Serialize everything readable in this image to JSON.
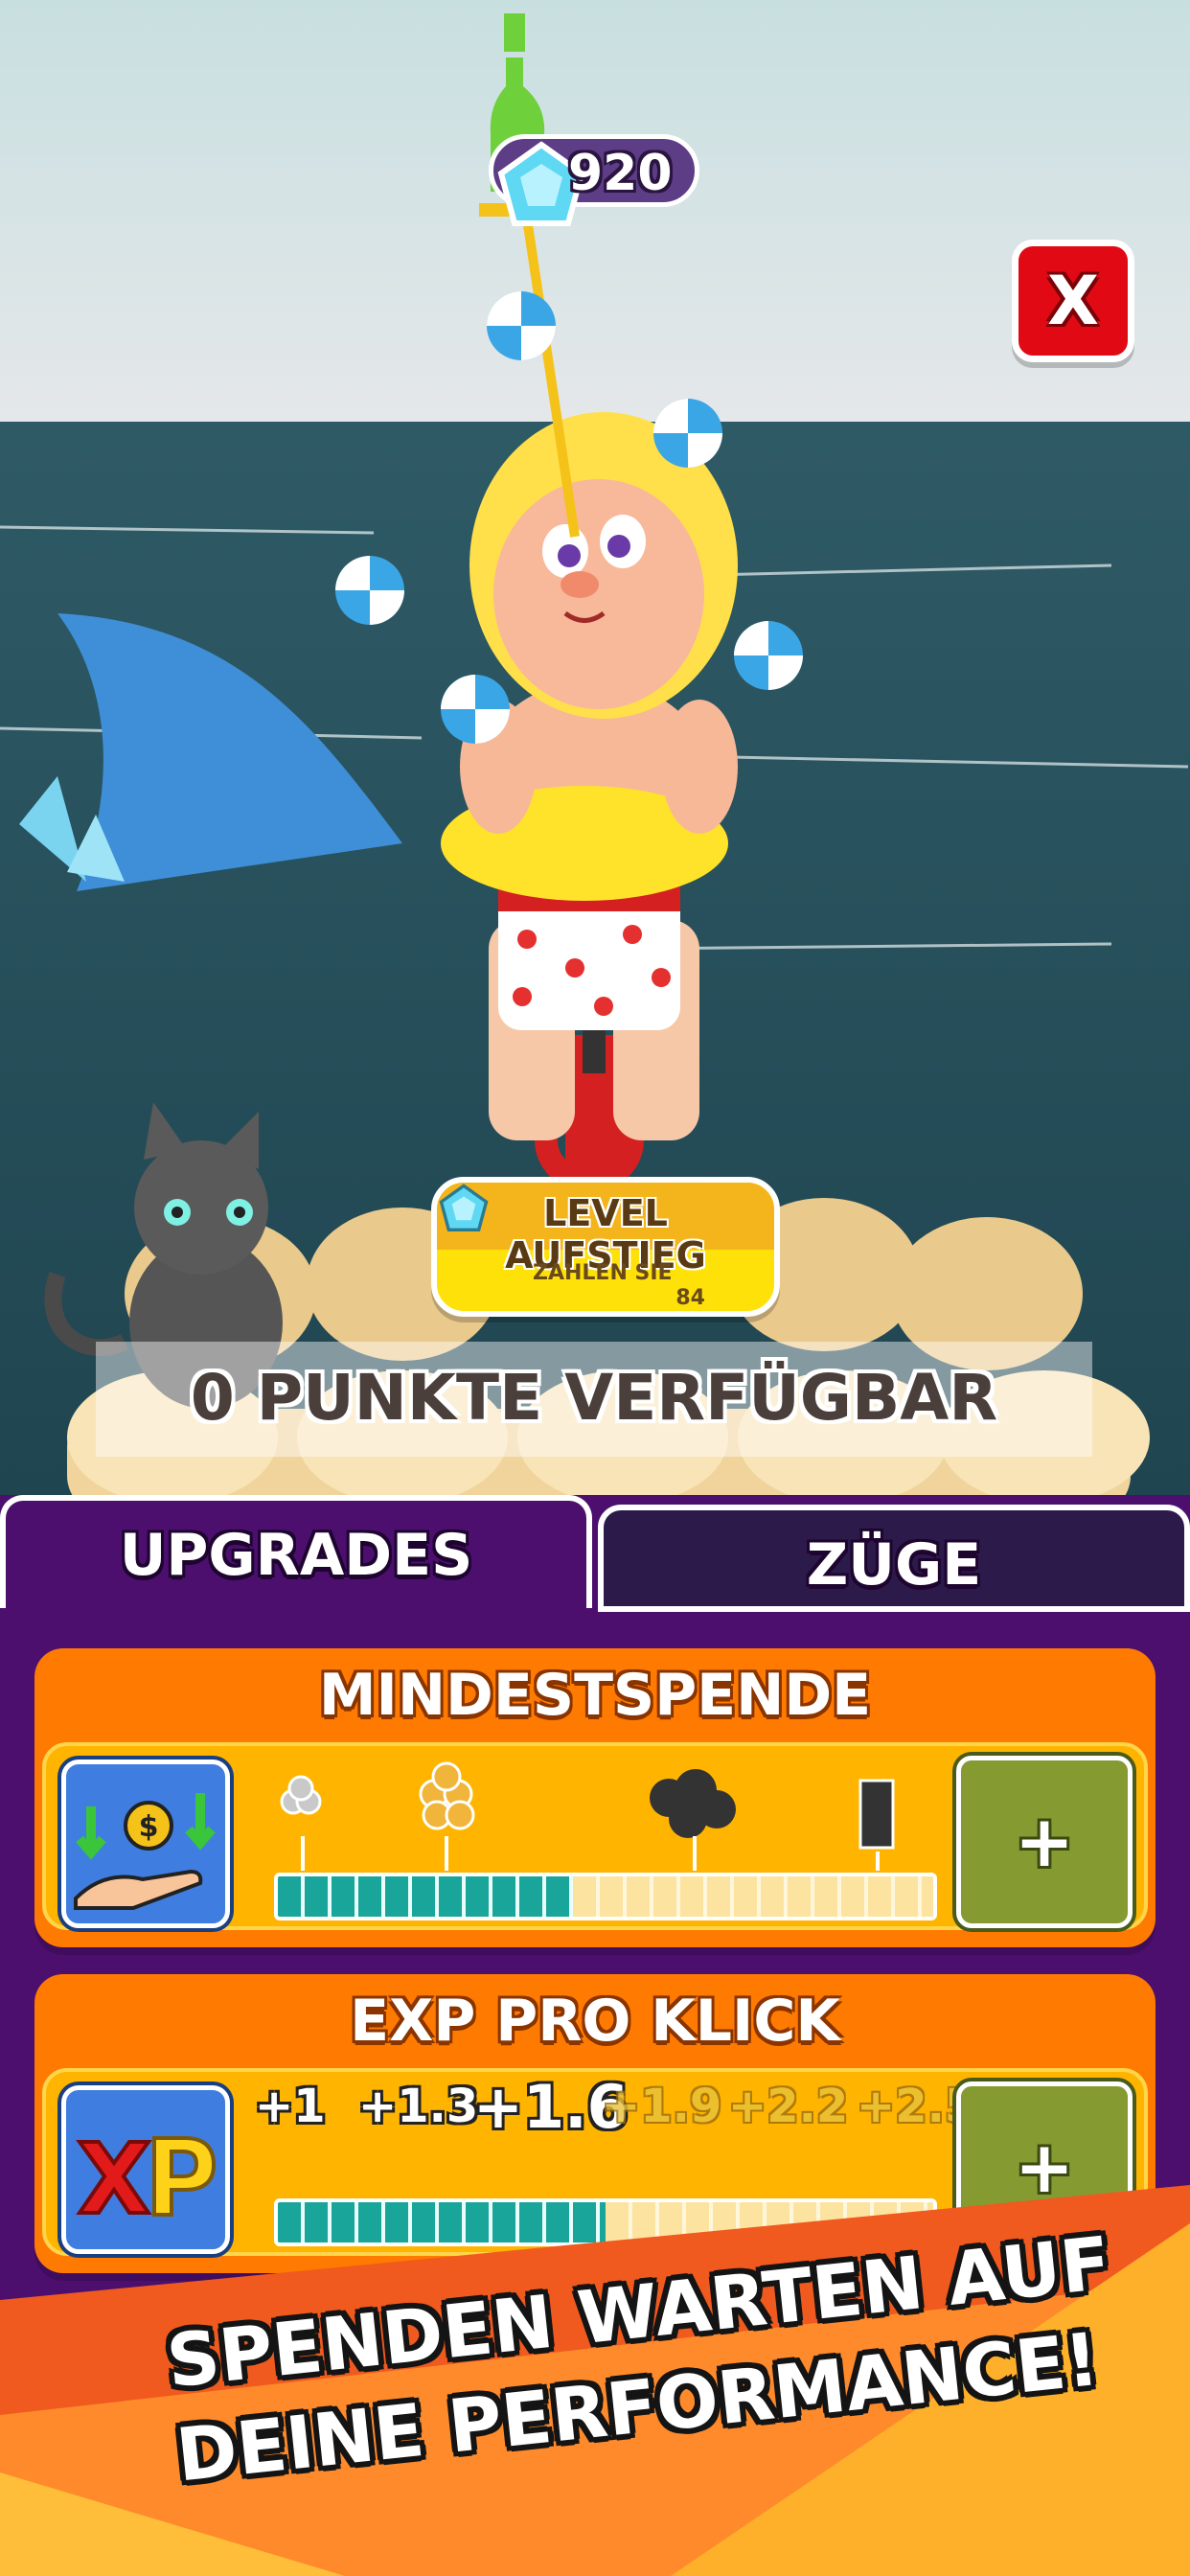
{
  "hud": {
    "gems": "920",
    "close_label": "X"
  },
  "level_up": {
    "title": "LEVEL AUFSTIEG",
    "subtitle": "ZAHLEN SIE",
    "cost": "84"
  },
  "points": {
    "label": "0 PUNKTE VERFÜGBAR"
  },
  "tabs": [
    {
      "label": "UPGRADES",
      "active": true
    },
    {
      "label": "ZÜGE",
      "active": false
    }
  ],
  "upgrades": [
    {
      "title": "MINDESTSPENDE",
      "plus_label": "+",
      "progress": 0.45,
      "icon": "donation-hand-icon"
    },
    {
      "title": "EXP PRO KLICK",
      "plus_label": "+",
      "progress": 0.5,
      "icon": "xp-icon",
      "steps": [
        "+1",
        "+1.3",
        "+1.6",
        "+1.9",
        "+2.2",
        "+2.5"
      ],
      "current_step": "+1.6"
    }
  ],
  "promo": {
    "line1": "SPENDEN WARTEN AUF",
    "line2": "DEINE PERFORMANCE!"
  },
  "colors": {
    "panel": "#4c0f6e",
    "card": "#ff7a00",
    "card_body": "#ffb400",
    "progress_fill": "#1aa59a",
    "close_button": "#e10a14",
    "plus_button": "#869a32"
  }
}
